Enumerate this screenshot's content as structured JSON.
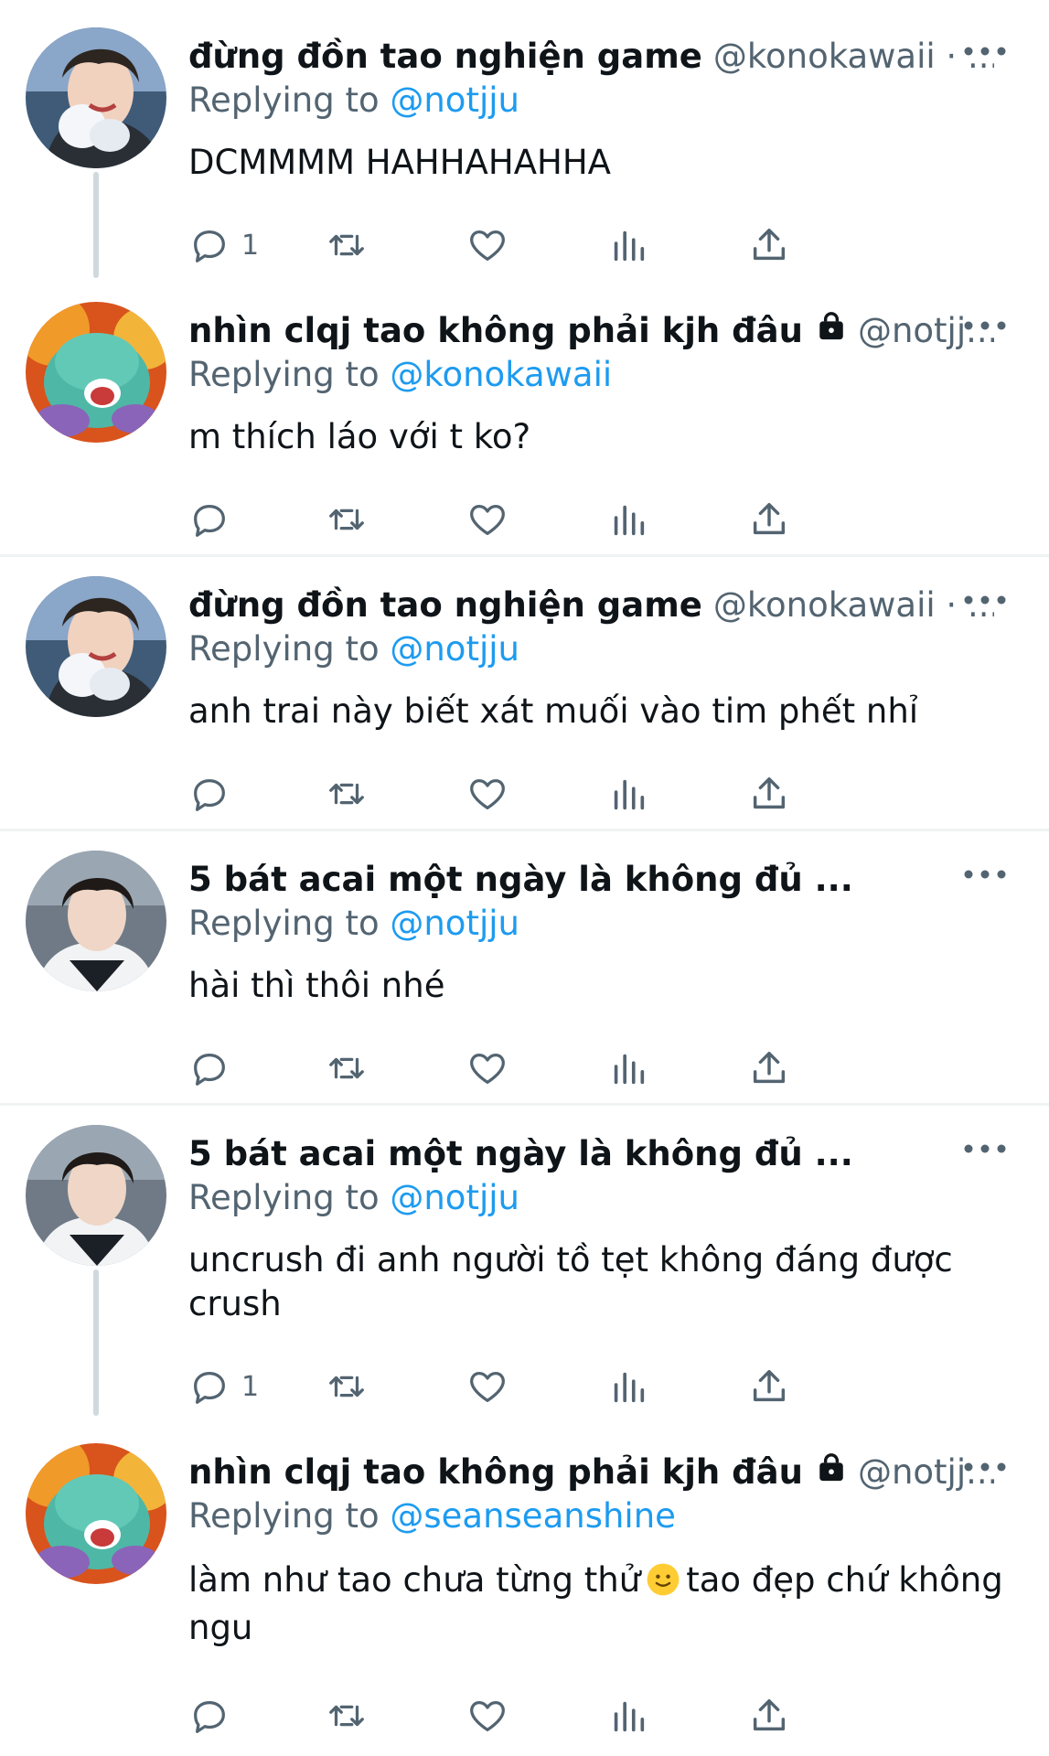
{
  "tweets": [
    {
      "name": "đừng đồn tao nghiện game",
      "handle": "@konokawaii · ...",
      "reply_prefix": "Replying to ",
      "reply_to": "@notjju",
      "text": "DCMMMM HAHHAHAHHA",
      "reply_count": "1",
      "locked": false,
      "avatar": "avatar-anime-boy"
    },
    {
      "name": "nhìn clqj tao không phải kjh đâu",
      "handle": "@notjj...",
      "reply_prefix": "Replying to ",
      "reply_to": "@konokawaii",
      "text": "m thích láo với t ko?",
      "reply_count": "",
      "locked": true,
      "avatar": "avatar-green-creature"
    },
    {
      "name": "đừng đồn tao nghiện game",
      "handle": "@konokawaii · ...",
      "reply_prefix": "Replying to ",
      "reply_to": "@notjju",
      "text": "anh trai này biết xát muối vào tim phết nhỉ",
      "reply_count": "",
      "locked": false,
      "avatar": "avatar-anime-boy"
    },
    {
      "name": "5 bát acai một ngày là không đủ ...",
      "handle": "",
      "reply_prefix": "Replying to ",
      "reply_to": "@notjju",
      "text": "hài thì thôi nhé",
      "reply_count": "",
      "locked": false,
      "avatar": "avatar-selfie-boy"
    },
    {
      "name": "5 bát acai một ngày là không đủ ...",
      "handle": "",
      "reply_prefix": "Replying to ",
      "reply_to": "@notjju",
      "text": "uncrush đi anh người tồ tẹt không đáng được crush",
      "reply_count": "1",
      "locked": false,
      "avatar": "avatar-selfie-boy"
    },
    {
      "name": "nhìn clqj tao không phải kjh đâu",
      "handle": "@notjj...",
      "reply_prefix": "Replying to ",
      "reply_to": "@seanseanshine",
      "text_before": "làm như tao chưa từng thử",
      "text_after": "tao đẹp chứ không ngu",
      "reply_count": "",
      "locked": true,
      "avatar": "avatar-green-creature"
    }
  ],
  "icons": {
    "reply": "reply-bubble-icon",
    "retweet": "retweet-icon",
    "like": "heart-icon",
    "views": "views-bar-chart-icon",
    "share": "share-upload-icon",
    "more": "more-dots-icon",
    "lock": "lock-icon",
    "emoji": "slightly-smiling-face-emoji"
  },
  "colors": {
    "link": "#1d9bf0",
    "secondary": "#536471",
    "text": "#0f1419",
    "divider": "#eff3f4",
    "thread_line": "#cfd9de"
  }
}
